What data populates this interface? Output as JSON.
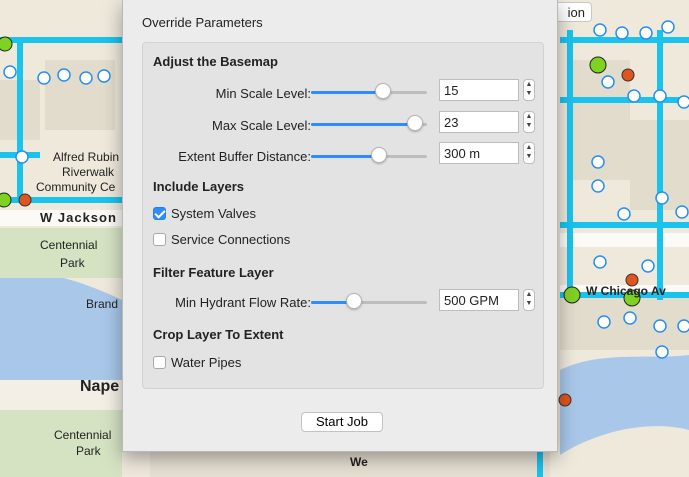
{
  "map": {
    "labels": [
      {
        "text": "Alfred Rubin",
        "color": "#6b6b6b"
      },
      {
        "text": "Riverwalk",
        "color": "#6b6b6b"
      },
      {
        "text": "Community Ce",
        "color": "#6b6b6b"
      },
      {
        "text": "W Jackson",
        "color": "#444444"
      },
      {
        "text": "Centennial",
        "color": "#5b7f5b"
      },
      {
        "text": "Park",
        "color": "#5b7f5b"
      },
      {
        "text": "Brand",
        "color": "#6d86a6"
      },
      {
        "text": "Nape",
        "color": "#222222"
      },
      {
        "text": "Centennial",
        "color": "#5b7f5b"
      },
      {
        "text": "Park",
        "color": "#5b7f5b"
      },
      {
        "text": "W Chicago Av",
        "color": "#444444"
      },
      {
        "text": "We",
        "color": "#444444"
      }
    ],
    "top_button_label": "ion",
    "colors": {
      "pipe": "#19c3ee",
      "water": "#a9c7e9",
      "park": "#d5e3c3",
      "meter": "#2a8ef0"
    }
  },
  "dialog": {
    "title": "Override Parameters",
    "basemap": {
      "heading": "Adjust the Basemap",
      "min_scale": {
        "label": "Min Scale Level:",
        "value": "15",
        "level": 0.64
      },
      "max_scale": {
        "label": "Max Scale Level:",
        "value": "23",
        "level": 0.96
      },
      "extent_buffer": {
        "label": "Extent Buffer Distance:",
        "value": "300 m",
        "level": 0.6
      }
    },
    "layers": {
      "heading": "Include Layers",
      "system_valves": {
        "label": "System Valves",
        "checked": true
      },
      "service_connections": {
        "label": "Service Connections",
        "checked": false
      }
    },
    "filter": {
      "heading": "Filter Feature Layer",
      "hydrant_flow": {
        "label": "Min Hydrant Flow Rate:",
        "value": "500 GPM",
        "level": 0.35
      }
    },
    "crop": {
      "heading": "Crop Layer To Extent",
      "water_pipes": {
        "label": "Water Pipes",
        "checked": false
      }
    },
    "start_button": "Start Job",
    "stepper_glyphs": {
      "up": "▲",
      "down": "▼"
    }
  }
}
